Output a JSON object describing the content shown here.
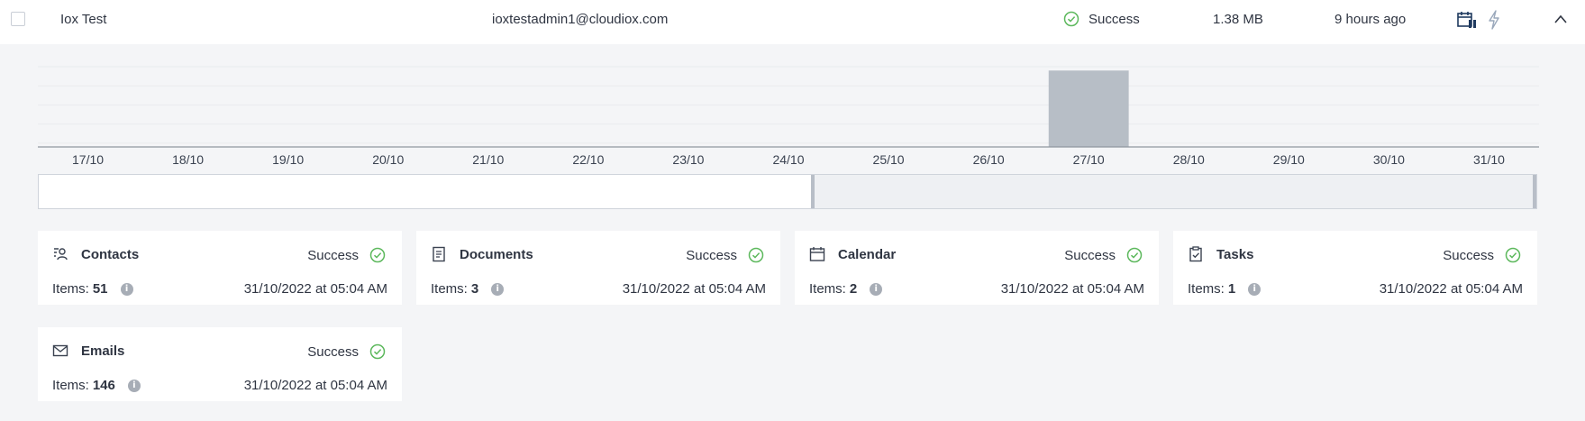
{
  "row": {
    "name": "Iox Test",
    "email": "ioxtestadmin1@cloudiox.com",
    "status": "Success",
    "size": "1.38 MB",
    "last_backup": "9 hours ago"
  },
  "colors": {
    "success": "#5cb85c",
    "bar": "#b7bec6",
    "text": "#2f3542",
    "icon": "#1f3a5f"
  },
  "chart_data": {
    "type": "bar",
    "categories": [
      "17/10",
      "18/10",
      "19/10",
      "20/10",
      "21/10",
      "22/10",
      "23/10",
      "24/10",
      "25/10",
      "26/10",
      "27/10",
      "28/10",
      "29/10",
      "30/10",
      "31/10"
    ],
    "values": [
      0,
      0,
      0,
      0,
      0,
      0,
      0,
      0,
      0,
      0,
      1,
      0,
      0,
      0,
      0
    ],
    "ylim": [
      0,
      1.05
    ],
    "grid": true,
    "legend": "none",
    "navigator_range": [
      0.517,
      1.0
    ]
  },
  "cards": [
    {
      "title": "Contacts",
      "icon": "contacts-icon",
      "status": "Success",
      "items_label": "Items:",
      "items_count": "51",
      "date": "31/10/2022 at 05:04 AM"
    },
    {
      "title": "Documents",
      "icon": "document-icon",
      "status": "Success",
      "items_label": "Items:",
      "items_count": "3",
      "date": "31/10/2022 at 05:04 AM"
    },
    {
      "title": "Calendar",
      "icon": "calendar-icon",
      "status": "Success",
      "items_label": "Items:",
      "items_count": "2",
      "date": "31/10/2022 at 05:04 AM"
    },
    {
      "title": "Tasks",
      "icon": "tasks-icon",
      "status": "Success",
      "items_label": "Items:",
      "items_count": "1",
      "date": "31/10/2022 at 05:04 AM"
    },
    {
      "title": "Emails",
      "icon": "email-icon",
      "status": "Success",
      "items_label": "Items:",
      "items_count": "146",
      "date": "31/10/2022 at 05:04 AM"
    }
  ]
}
